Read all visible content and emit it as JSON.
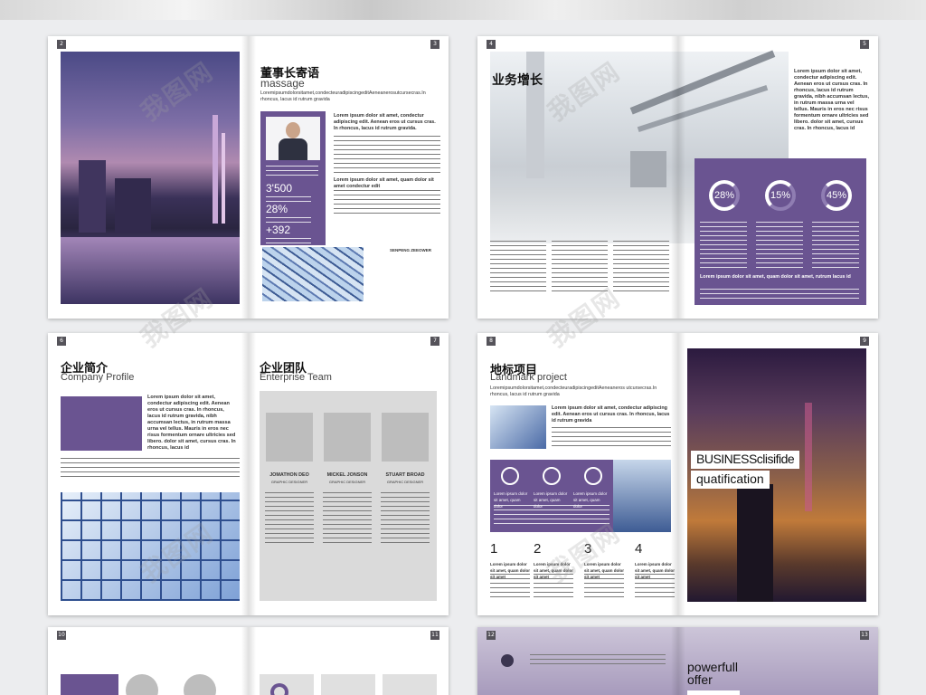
{
  "pages": {
    "p2": "2",
    "p3": "3",
    "p4": "4",
    "p5": "5",
    "p6": "6",
    "p7": "7",
    "p8": "8",
    "p9": "9",
    "p10": "10",
    "p11": "11",
    "p12": "12",
    "p13": "13"
  },
  "s1": {
    "title_cn": "董事长寄语",
    "title_en": "massage",
    "subtitle": "Loremipsumdolorsitamet,condecteuradipiscingeditAeneanerosutcursecras.In rhoncus, lacus id rutrum gravida",
    "body_lead": "Lorem ipsum dolor sit amet, condectur adipiscing edit. Aenean eros ut cursus cras. In rhoncus, lacus id rutrum gravida.",
    "body_bold2": "Lorem ipsum dolor sit amet, quam dolor sit amet condectur edit",
    "stat1": "3'500",
    "stat2": "28%",
    "stat3": "+392",
    "signature": "SENPENG ZEEOWER"
  },
  "s2": {
    "title_cn": "业务增长",
    "right_text": "Lorem ipsum dolor sit amet, condectur adipiscing edit. Aenean eros ut cursus cras. In rhoncus, lacus id rutrum gravida, nibh accumsan lectus, in rutrum massa urna vel tellus. Mauris in eros nec risus formentum ornare ultricies sed libero. dolor sit amet, cursus cras. In rhoncus, lacus id",
    "pct1": "28%",
    "pct2": "15%",
    "pct3": "45%",
    "panel_bottom": "Lorem ipsum dolor sit amet, quam dolor sit amet, rutrum lacus id"
  },
  "s3": {
    "left_title_cn": "企业简介",
    "left_title_en": "Company Profile",
    "left_body": "Lorem ipsum dolor sit amet, condectur adipiscing edit. Aenean eros ut cursus cras. In rhoncus, lacus id rutrum gravida, nibh accumsan lectus, in rutrum massa urna vel tellus. Mauris in eros nec risus formentum ornare ultricies sed libero. dolor sit amet, cursus cras. In rhoncus, lacus id",
    "right_title_cn": "企业团队",
    "right_title_en": "Enterprise Team",
    "team": [
      {
        "name": "JOMATHON DEO",
        "role": "GRAPHIC DESIGNER"
      },
      {
        "name": "MICKEL JONSON",
        "role": "GRAPHIC DESIGNER"
      },
      {
        "name": "STUART BROAD",
        "role": "GRAPHIC DESIGNER"
      }
    ]
  },
  "s4": {
    "title_cn": "地标项目",
    "title_en": "Landmark project",
    "subtitle": "Loremipsumdolorsitamet,condecteuradipiscingeditAeneaneros utcursecras.In rhoncus, lacus id rutrum gravida",
    "lead": "Lorem ipsum dolor sit amet, condectur adipiscing edit. Aenean eros ut cursus cras. In rhoncus, lacus id rutrum gravida",
    "icon_caption": "Lorem ipsum dolor sit amet, quam dolor",
    "steps": [
      "1",
      "2",
      "3",
      "4"
    ],
    "step_caption": "Lorem ipsum dolor sit amet, quam dolor sit amet",
    "banner1": "BUSINESSclisifide",
    "banner2": "quatification"
  },
  "s6": {
    "title1": "powerfull",
    "title2": "offer"
  },
  "watermark": "我图网"
}
